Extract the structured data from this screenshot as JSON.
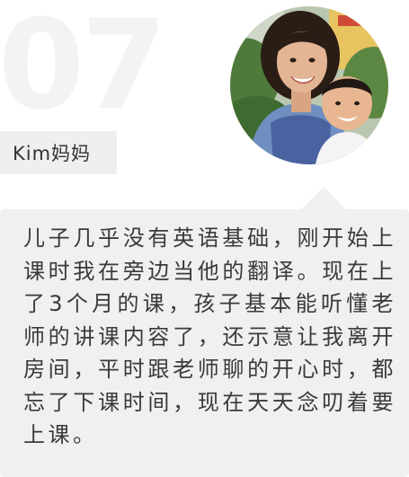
{
  "testimonial": {
    "number": "07",
    "name": "Kim妈妈",
    "quote": "儿子几乎没有英语基础，刚开始上课时我在旁边当他的翻译。现在上了3个月的课，孩子基本能听懂老师的讲课内容了，还示意让我离开房间，平时跟老师聊的开心时，都忘了下课时间，现在天天念叨着要上课。"
  },
  "colors": {
    "background": "#ffffff",
    "bubble": "#f0f0f0",
    "name_tag": "#efefef",
    "text": "#3a3a3a",
    "number": "#f3f3f3"
  }
}
